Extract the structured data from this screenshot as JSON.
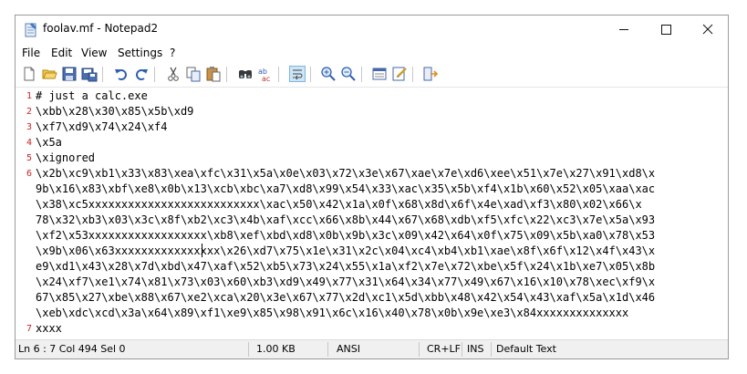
{
  "window": {
    "title": "foolav.mf - Notepad2"
  },
  "menu": [
    "File",
    "Edit",
    "View",
    "Settings",
    "?"
  ],
  "toolbar_icons": [
    "new-file-icon",
    "open-file-icon",
    "save-icon",
    "save-as-icon",
    "undo-icon",
    "redo-icon",
    "cut-icon",
    "copy-icon",
    "paste-icon",
    "find-icon",
    "replace-icon",
    "word-wrap-icon",
    "zoom-in-icon",
    "zoom-out-icon",
    "view-icon",
    "settings-icon",
    "exit-icon"
  ],
  "editor": {
    "lines": [
      {
        "num": "1",
        "text": "# just a calc.exe"
      },
      {
        "num": "2",
        "text": "\\xbb\\x28\\x30\\x85\\x5b\\xd9"
      },
      {
        "num": "3",
        "text": "\\xf7\\xd9\\x74\\x24\\xf4"
      },
      {
        "num": "4",
        "text": "\\x5a"
      },
      {
        "num": "5",
        "text": "\\xignored"
      },
      {
        "num": "6",
        "text": "\\x2b\\xc9\\xb1\\x33\\x83\\xea\\xfc\\x31\\x5a\\x0e\\x03\\x72\\x3e\\x67\\xae\\x7e\\xd6\\xee\\x51\\x7e\\x27\\x91\\xd8\\x"
      },
      {
        "num": "",
        "text": "9b\\x16\\x83\\xbf\\xe8\\x0b\\x13\\xcb\\xbc\\xa7\\xd8\\x99\\x54\\x33\\xac\\x35\\x5b\\xf4\\x1b\\x60\\x52\\x05\\xaa\\xac"
      },
      {
        "num": "",
        "text": "\\x38\\xc5xxxxxxxxxxxxxxxxxxxxxxxxxx\\xac\\x50\\x42\\x1a\\x0f\\x68\\x8d\\x6f\\x4e\\xad\\xf3\\x80\\x02\\x66\\x"
      },
      {
        "num": "",
        "text": "78\\x32\\xb3\\x03\\x3c\\x8f\\xb2\\xc3\\x4b\\xaf\\xcc\\x66\\x8b\\x44\\x67\\x68\\xdb\\xf5\\xfc\\x22\\xc3\\x7e\\x5a\\x93"
      },
      {
        "num": "",
        "text": "\\xf2\\x53xxxxxxxxxxxxxxxxxx\\xb8\\xef\\xbd\\xd8\\x0b\\x9b\\x3c\\x09\\x42\\x64\\x0f\\x75\\x09\\x5b\\xa0\\x78\\x53"
      },
      {
        "num": "",
        "text": "\\x9b\\x06\\x63xxxxxxxxxxxxxxxx\\x26\\xd7\\x75\\x1e\\x31\\x2c\\x04\\xc4\\xb4\\xb1\\xae\\x8f\\x6f\\x12\\x4f\\x43\\x"
      },
      {
        "num": "",
        "text": "e9\\xd1\\x43\\x28\\x7d\\xbd\\x47\\xaf\\x52\\xb5\\x73\\x24\\x55\\x1a\\xf2\\x7e\\x72\\xbe\\x5f\\x24\\x1b\\xe7\\x05\\x8b"
      },
      {
        "num": "",
        "text": "\\x24\\xf7\\xe1\\x74\\x81\\x73\\x03\\x60\\xb3\\xd9\\x49\\x77\\x31\\x64\\x34\\x77\\x49\\x67\\x16\\x10\\x78\\xec\\xf9\\x"
      },
      {
        "num": "",
        "text": "67\\x85\\x27\\xbe\\x88\\x67\\xe2\\xca\\x20\\x3e\\x67\\x77\\x2d\\xc1\\x5d\\xbb\\x48\\x42\\x54\\x43\\xaf\\x5a\\x1d\\x46"
      },
      {
        "num": "",
        "text": "\\xeb\\xdc\\xcd\\x3a\\x64\\x89\\xf1\\xe9\\x85\\x98\\x91\\x6c\\x16\\x40\\x78\\x0b\\x9e\\xe3\\x84xxxxxxxxxxxxxx"
      },
      {
        "num": "7",
        "text": "xxxx"
      }
    ]
  },
  "status": {
    "position": "Ln 6 : 7   Col 494   Sel 0",
    "size": "1.00 KB",
    "encoding": "ANSI",
    "line_ending": "CR+LF",
    "mode": "INS",
    "scheme": "Default Text"
  },
  "colors": {
    "line_number": "#cc2222",
    "accent": "#3c78c8"
  }
}
